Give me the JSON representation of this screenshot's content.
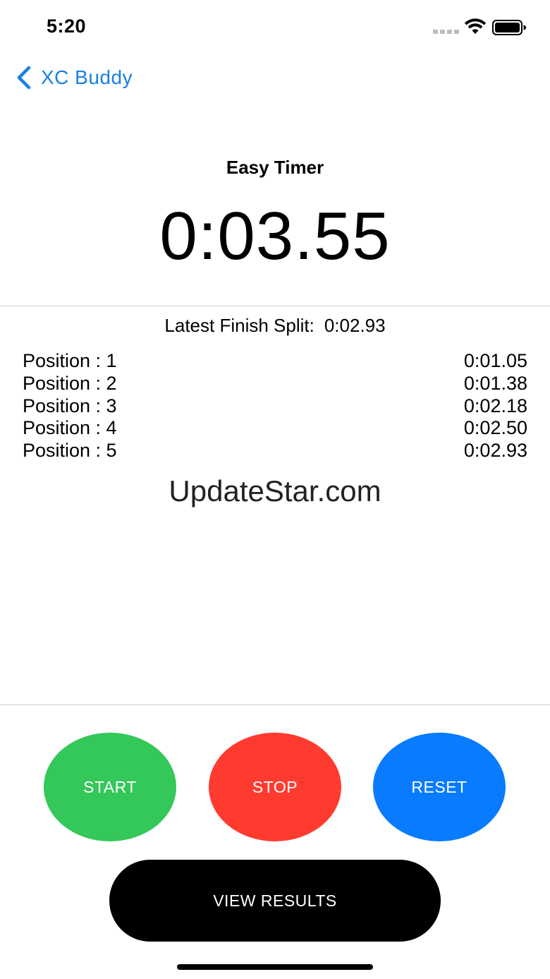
{
  "status_bar": {
    "time": "5:20",
    "icons": [
      "signal-icon",
      "wifi-icon",
      "battery-icon"
    ]
  },
  "nav": {
    "back_label": "XC Buddy",
    "back_icon": "chevron-left-icon"
  },
  "timer": {
    "title": "Easy Timer",
    "display": "0:03.55"
  },
  "latest_split": {
    "label": "Latest Finish Split:",
    "value": "0:02.93"
  },
  "results": [
    {
      "label": "Position : 1",
      "time": "0:01.05"
    },
    {
      "label": "Position : 2",
      "time": "0:01.38"
    },
    {
      "label": "Position : 3",
      "time": "0:02.18"
    },
    {
      "label": "Position : 4",
      "time": "0:02.50"
    },
    {
      "label": "Position : 5",
      "time": "0:02.93"
    }
  ],
  "watermark": "UpdateStar.com",
  "controls": {
    "start_label": "START",
    "stop_label": "STOP",
    "reset_label": "RESET",
    "view_results_label": "VIEW RESULTS"
  },
  "colors": {
    "accent": "#1a7fe0",
    "start": "#34c759",
    "stop": "#ff3b30",
    "reset": "#087bff",
    "view_results": "#000000"
  }
}
